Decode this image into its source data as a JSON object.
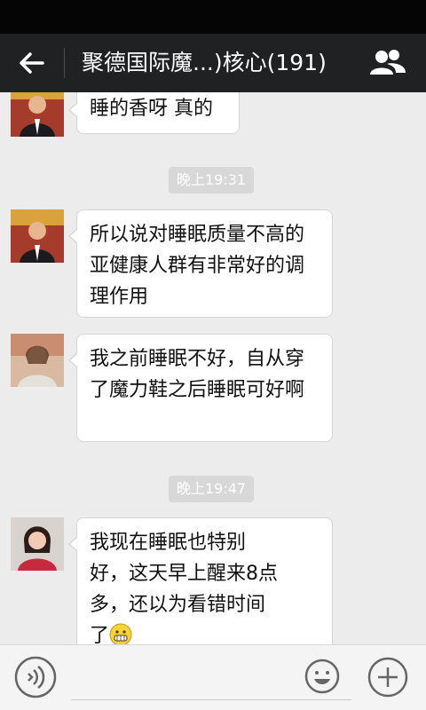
{
  "header": {
    "title": "聚德国际魔...)核心(191)",
    "back_icon": "back-arrow-icon",
    "members_icon": "group-members-icon"
  },
  "messages": [
    {
      "text": "睡的香呀 真的",
      "avatar": "man-in-suit-avatar"
    },
    {
      "text": "所以说对睡眠质量不高的亚健康人群有非常好的调理作用",
      "avatar": "man-in-suit-avatar"
    },
    {
      "text": "我之前睡眠不好，自从穿了魔力鞋之后睡眠可好啊",
      "avatar": "woman-avatar"
    },
    {
      "text": "我现在睡眠也特别好，这天早上醒来8点多，还以为看错时间了",
      "emoji": "grinning-emoji",
      "avatar": "woman-red-dress-avatar"
    }
  ],
  "timestamps": [
    "晚上19:31",
    "晚上19:47"
  ],
  "input": {
    "voice_icon": "voice-input-icon",
    "emoji_icon": "emoji-icon",
    "plus_icon": "plus-icon"
  },
  "colors": {
    "topbar": "#1f2123",
    "chat_bg": "#ececec",
    "bubble": "#ffffff"
  }
}
